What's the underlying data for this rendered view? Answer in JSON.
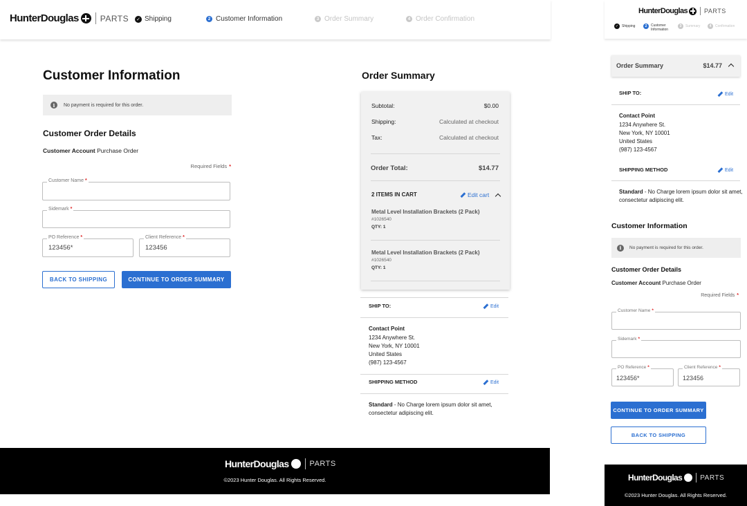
{
  "brand": {
    "name": "HunterDouglas",
    "sub": "PARTS"
  },
  "steps": [
    {
      "number": "1",
      "label": "Shipping",
      "state": "done"
    },
    {
      "number": "2",
      "label": "Customer Information",
      "state": "active"
    },
    {
      "number": "3",
      "label": "Order Summary",
      "state": "future"
    },
    {
      "number": "4",
      "label": "Order Confirmation",
      "state": "future"
    }
  ],
  "mobile_steps": [
    {
      "number": "1",
      "label": "Shipping",
      "state": "done"
    },
    {
      "number": "2",
      "label_line1": "Customer",
      "label_line2": "Information",
      "state": "active"
    },
    {
      "number": "3",
      "label": "Summary",
      "state": "future"
    },
    {
      "number": "4",
      "label": "Confirmation",
      "state": "future"
    }
  ],
  "customer_info": {
    "title": "Customer Information",
    "notice": "No payment is required for this order.",
    "details_heading": "Customer Order Details",
    "account_label": "Customer Account",
    "account_value": "Purchase Order",
    "required_note": "Required Fields",
    "required_marker": "*"
  },
  "form": {
    "customer_name": {
      "label": "Customer Name",
      "value": ""
    },
    "sidemark": {
      "label": "Sidemark",
      "value": ""
    },
    "po_reference": {
      "label": "PO Reference",
      "value": "123456*"
    },
    "client_reference": {
      "label": "Client Reference",
      "value": "123456"
    }
  },
  "buttons": {
    "back": "BACK TO SHIPPING",
    "continue": "CONTINUE TO ORDER SUMMARY"
  },
  "order_summary": {
    "title": "Order Summary",
    "subtotal_label": "Subtotal:",
    "subtotal_value": "$0.00",
    "shipping_label": "Shipping:",
    "shipping_value": "Calculated at checkout",
    "tax_label": "Tax:",
    "tax_value": "Calculated at checkout",
    "total_label": "Order Total:",
    "total_value": "$14.77",
    "items_heading": "2 ITEMS IN CART",
    "edit_cart": "Edit cart",
    "items": [
      {
        "name": "Metal Level Installation Brackets (2 Pack)",
        "sku": "#1026540",
        "qty": "QTY: 1"
      },
      {
        "name": "Metal Level Installation Brackets (2 Pack)",
        "sku": "#1026540",
        "qty": "QTY: 1"
      }
    ]
  },
  "ship_to": {
    "heading": "SHIP TO:",
    "edit": "Edit",
    "name": "Contact Point",
    "address1": "1234 Anywhere St.",
    "address2": "New York, NY 10001",
    "country": "United States",
    "phone": "(987) 123-4567"
  },
  "shipping_method": {
    "heading": "SHIPPING METHOD",
    "edit": "Edit",
    "method": "Standard",
    "description": " - No Charge lorem ipsum dolor sit amet, consectetur adipiscing elit."
  },
  "footer": {
    "copyright": "©2023 Hunter Douglas. All Rights Reserved."
  },
  "colors": {
    "accent": "#2b6fd1",
    "required": "#d22222",
    "footer_bg": "#000000",
    "panel_bg": "#f1f1f1"
  },
  "icons": {
    "check": "check-icon",
    "info": "info-icon",
    "pencil": "pencil-icon",
    "chevron": "chevron-up-icon",
    "brand": "hunterdouglas-logo-icon"
  }
}
